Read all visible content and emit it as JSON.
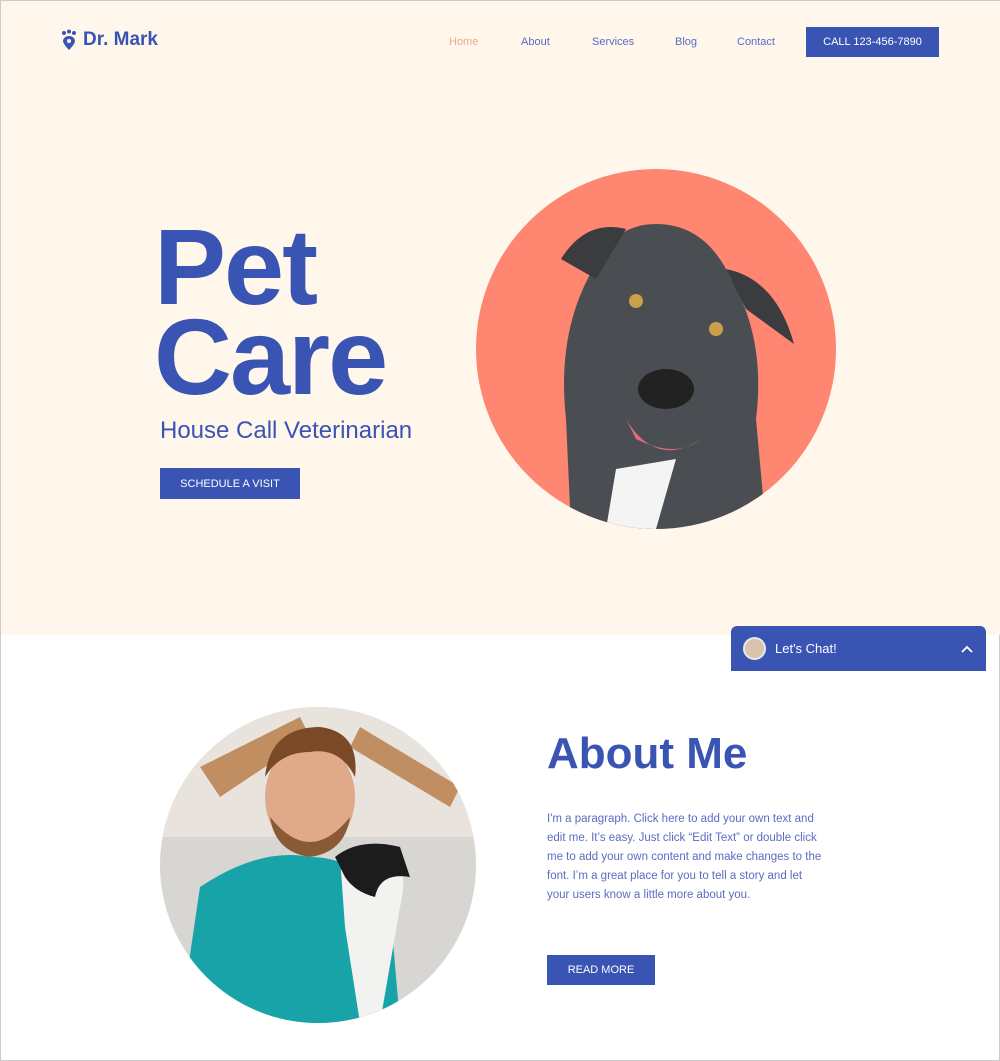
{
  "header": {
    "logo": "Dr. Mark",
    "nav": [
      "Home",
      "About",
      "Services",
      "Blog",
      "Contact"
    ],
    "active": "Home",
    "call": "CALL 123-456-7890"
  },
  "hero": {
    "line1": "Pet",
    "line2": "Care",
    "subtitle": "House Call Veterinarian",
    "button": "SCHEDULE A VISIT"
  },
  "about": {
    "title": "About Me",
    "paragraph": "I'm a paragraph. Click here to add your own text and edit me. It’s easy. Just click “Edit Text” or double click me to add your own content and make changes to the font. I’m a great place for you to tell a story and let your users know a little more about you.",
    "button": "READ MORE"
  },
  "chat": {
    "label": "Let's Chat!"
  },
  "colors": {
    "brand": "#3a54b4",
    "accent": "#ff8670",
    "hero_bg": "#fff7ec"
  }
}
